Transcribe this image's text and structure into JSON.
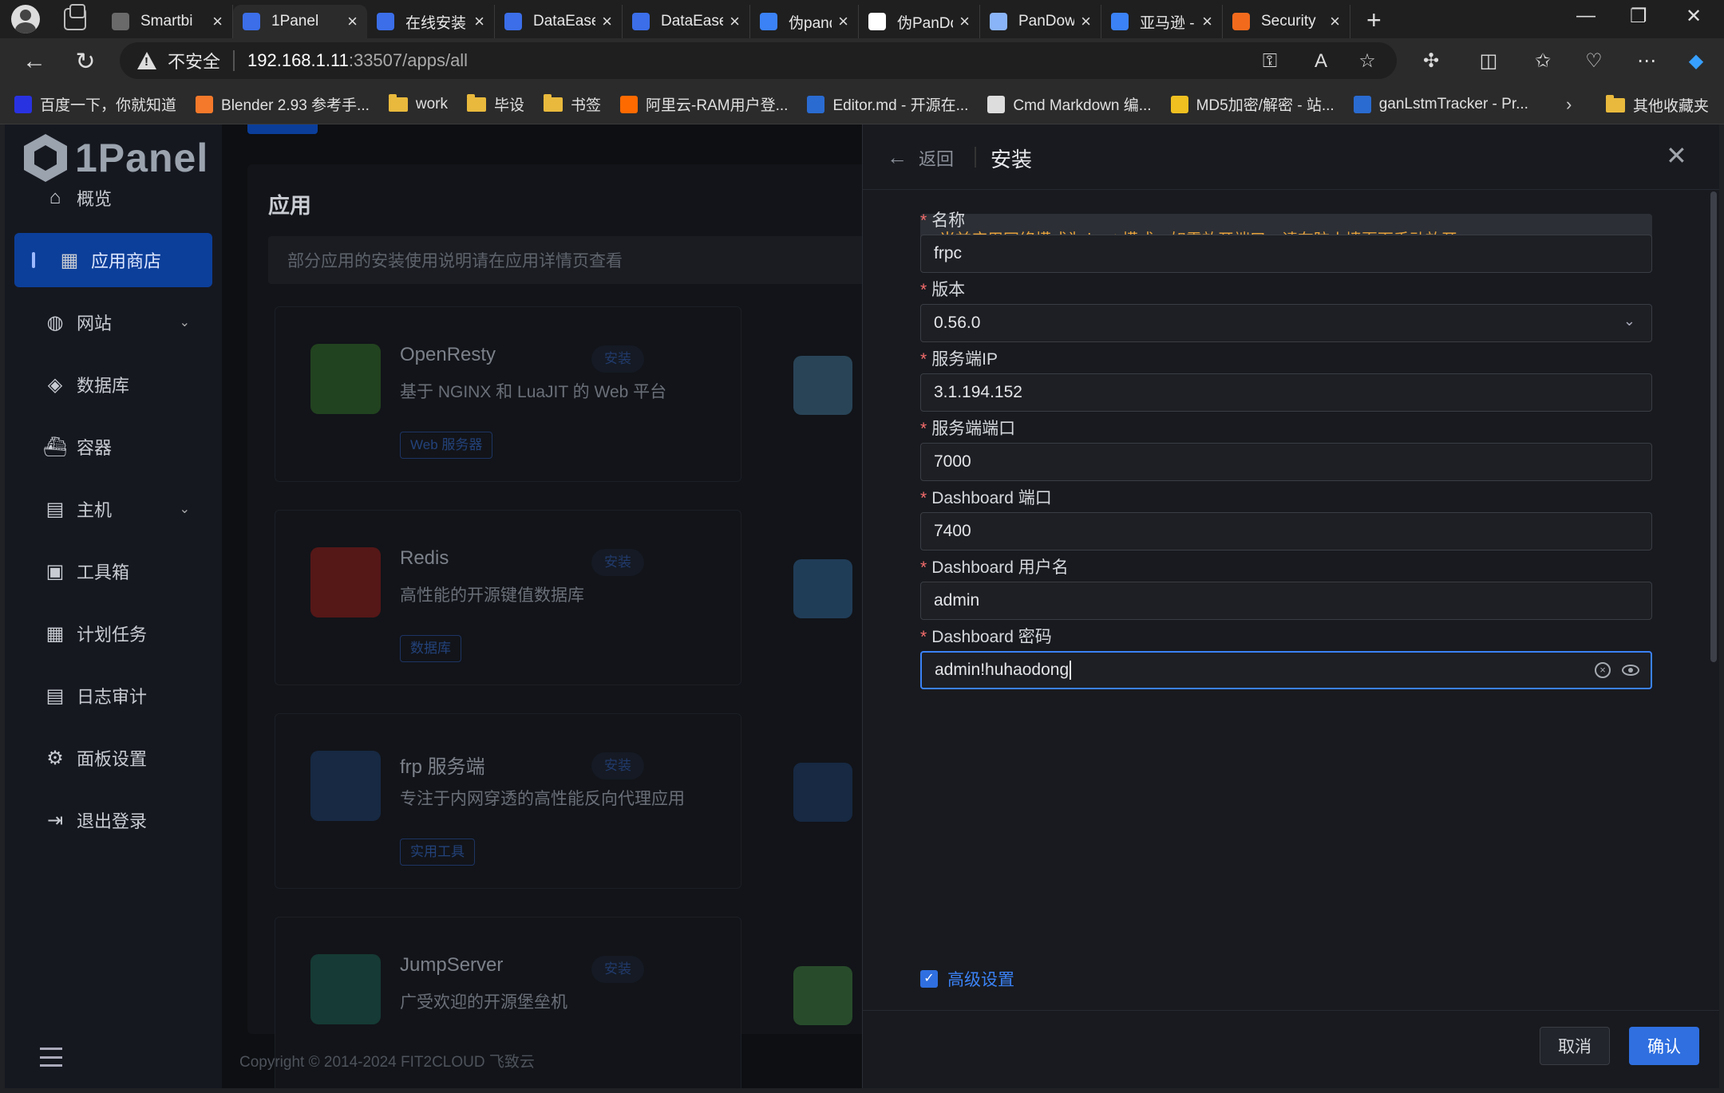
{
  "browser": {
    "tabs": [
      {
        "title": "Smartbi",
        "fav": "#6a6a6a"
      },
      {
        "title": "1Panel",
        "fav": "#3b6ee8",
        "active": true
      },
      {
        "title": "在线安装",
        "fav": "#3b6ee8"
      },
      {
        "title": "DataEase",
        "fav": "#3b6ee8"
      },
      {
        "title": "DataEase",
        "fav": "#3b6ee8"
      },
      {
        "title": "伪pando",
        "fav": "#3b82f6"
      },
      {
        "title": "伪PanDo",
        "fav": "#ffffff"
      },
      {
        "title": "PanDowr",
        "fav": "#8ab4f8"
      },
      {
        "title": "亚马逊 -",
        "fav": "#3b82f6"
      },
      {
        "title": "Security",
        "fav": "#f26b1d"
      }
    ],
    "security_label": "不安全",
    "url_host": "192.168.1.11",
    "url_rest": ":33507/apps/all",
    "bookmarks": [
      {
        "label": "百度一下，你就知道",
        "type": "site",
        "color": "#2932e1"
      },
      {
        "label": "Blender 2.93 参考手...",
        "type": "site",
        "color": "#f5792a"
      },
      {
        "label": "work",
        "type": "folder"
      },
      {
        "label": "毕设",
        "type": "folder"
      },
      {
        "label": "书签",
        "type": "folder"
      },
      {
        "label": "阿里云-RAM用户登...",
        "type": "site",
        "color": "#ff6a00"
      },
      {
        "label": "Editor.md - 开源在...",
        "type": "site",
        "color": "#2a6bd1"
      },
      {
        "label": "Cmd Markdown 编...",
        "type": "site",
        "color": "#dddddd"
      },
      {
        "label": "MD5加密/解密 - 站...",
        "type": "site",
        "color": "#f0c020"
      },
      {
        "label": "ganLstmTracker - Pr...",
        "type": "site",
        "color": "#2a6bd1"
      }
    ],
    "other_bookmarks": "其他收藏夹"
  },
  "sidebar": {
    "logo": "1Panel",
    "items": [
      {
        "label": "概览",
        "icon": "home-icon",
        "glyph": "⌂"
      },
      {
        "label": "应用商店",
        "icon": "grid-icon",
        "glyph": "▦",
        "active": true
      },
      {
        "label": "网站",
        "icon": "globe-icon",
        "glyph": "◍",
        "chevron": true
      },
      {
        "label": "数据库",
        "icon": "layers-icon",
        "glyph": "◈"
      },
      {
        "label": "容器",
        "icon": "docker-icon",
        "glyph": "⛴"
      },
      {
        "label": "主机",
        "icon": "server-icon",
        "glyph": "▤",
        "chevron": true
      },
      {
        "label": "工具箱",
        "icon": "toolbox-icon",
        "glyph": "▣"
      },
      {
        "label": "计划任务",
        "icon": "calendar-icon",
        "glyph": "▦"
      },
      {
        "label": "日志审计",
        "icon": "log-icon",
        "glyph": "▤"
      },
      {
        "label": "面板设置",
        "icon": "gear-icon",
        "glyph": "⚙"
      },
      {
        "label": "退出登录",
        "icon": "logout-icon",
        "glyph": "⇥"
      }
    ]
  },
  "main": {
    "title": "应用",
    "notice": "部分应用的安装使用说明请在应用详情页查看",
    "install_label": "安装",
    "apps": [
      {
        "name": "OpenResty",
        "desc": "基于 NGINX 和 LuaJIT 的 Web 平台",
        "tag": "Web 服务器",
        "logo": "#2f6a25"
      },
      {
        "name": "Redis",
        "desc": "高性能的开源键值数据库",
        "tag": "数据库",
        "logo": "#8e1a16"
      },
      {
        "name": "frp 服务端",
        "desc": "专注于内网穿透的高性能反向代理应用",
        "tag": "实用工具",
        "logo": "#1c3a66"
      },
      {
        "name": "JumpServer",
        "desc": "广受欢迎的开源堡垒机",
        "tag": "",
        "logo": "#1a5a4c"
      }
    ],
    "copyright": "Copyright © 2014-2024 FIT2CLOUD 飞致云"
  },
  "drawer": {
    "back": "返回",
    "title": "安装",
    "alert": "当前应用网络模式为 host 模式，如需放开端口，请在防火墙页面手动放开",
    "fields": [
      {
        "label": "名称",
        "value": "frpc"
      },
      {
        "label": "版本",
        "value": "0.56.0"
      },
      {
        "label": "服务端IP",
        "value": "3.1.194.152"
      },
      {
        "label": "服务端端口",
        "value": "7000"
      },
      {
        "label": "Dashboard 端口",
        "value": "7400"
      },
      {
        "label": "Dashboard 用户名",
        "value": "admin"
      },
      {
        "label": "Dashboard 密码",
        "value": "admin!huhaodong"
      }
    ],
    "advanced": "高级设置",
    "cancel": "取消",
    "confirm": "确认"
  }
}
